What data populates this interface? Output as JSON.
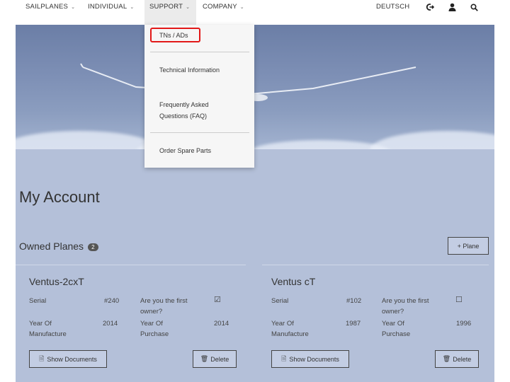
{
  "nav": {
    "items": [
      {
        "label": "SAILPLANES"
      },
      {
        "label": "INDIVIDUAL"
      },
      {
        "label": "SUPPORT"
      },
      {
        "label": "COMPANY"
      }
    ],
    "language": "DEUTSCH",
    "icons": [
      "logout-icon",
      "user-icon",
      "search-icon"
    ]
  },
  "dropdown": {
    "items": [
      {
        "label": "TNs / ADs"
      },
      {
        "label": "Technical Information"
      },
      {
        "label": "Frequently Asked"
      },
      {
        "label": "Questions (FAQ)"
      },
      {
        "label": "Order Spare Parts"
      }
    ]
  },
  "page": {
    "title": "My Account",
    "owned_planes_label": "Owned Planes",
    "owned_planes_count": "2",
    "add_plane_label": "+ Plane"
  },
  "planes": [
    {
      "name": "Ventus-2cxT",
      "serial_label": "Serial",
      "serial": "#240",
      "first_owner_label_1": "Are you the first",
      "first_owner_label_2": "owner?",
      "first_owner_mark": "☑",
      "yom_label_1": "Year Of",
      "yom_label_2": "Manufacture",
      "yom": "2014",
      "yop_label_1": "Year Of",
      "yop_label_2": "Purchase",
      "yop": "2014",
      "show_docs": "Show Documents",
      "delete": "Delete"
    },
    {
      "name": "Ventus cT",
      "serial_label": "Serial",
      "serial": "#102",
      "first_owner_label_1": "Are you the first",
      "first_owner_label_2": "owner?",
      "first_owner_mark": "☐",
      "yom_label_1": "Year Of",
      "yom_label_2": "Manufacture",
      "yom": "1987",
      "yop_label_1": "Year Of",
      "yop_label_2": "Purchase",
      "yop": "1996",
      "show_docs": "Show Documents",
      "delete": "Delete"
    }
  ],
  "colors": {
    "highlight": "#e21818",
    "content_bg": "#b4c0d9"
  }
}
